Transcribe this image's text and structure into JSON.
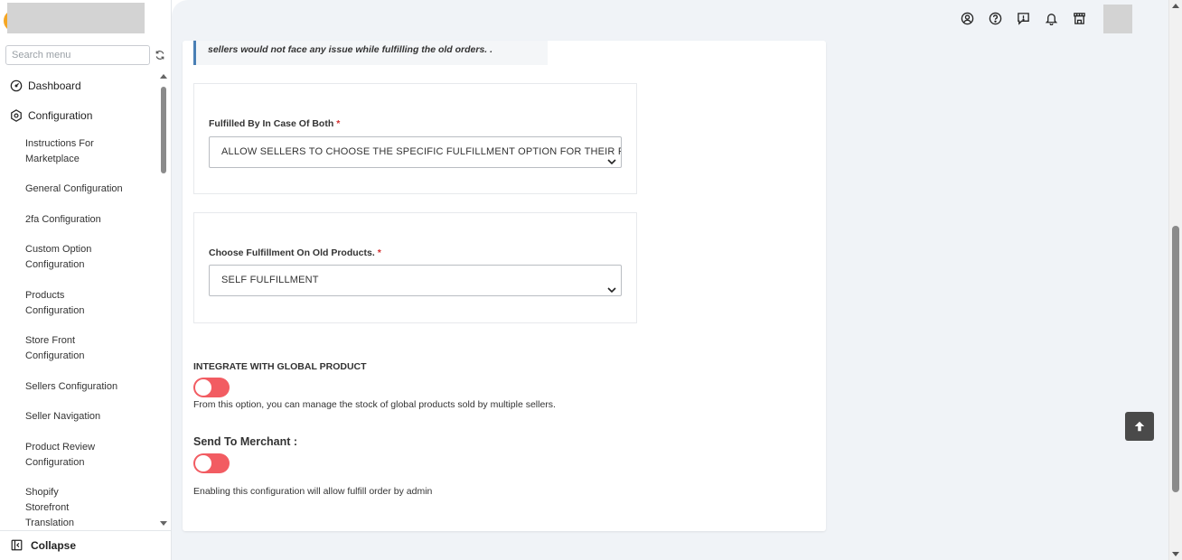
{
  "sidebar": {
    "search_placeholder": "Search menu",
    "top_items": [
      {
        "label": "Dashboard",
        "icon": "dashboard-icon"
      },
      {
        "label": "Configuration",
        "icon": "hexagon-gear-icon"
      }
    ],
    "sub_items": [
      "Instructions For Marketplace",
      "General Configuration",
      "2fa Configuration",
      "Custom Option Configuration",
      "Products Configuration",
      "Store Front Configuration",
      "Sellers Configuration",
      "Seller Navigation",
      "Product Review Configuration",
      "Shopify Storefront Translation"
    ],
    "collapse_label": "Collapse"
  },
  "topbar": {
    "icons": [
      "user-circle-icon",
      "help-circle-icon",
      "feedback-icon",
      "bell-icon",
      "store-icon"
    ]
  },
  "content": {
    "note": "sellers would not face any issue while fulfilling the old orders. .",
    "fulfilled_by": {
      "label": "Fulfilled By In Case Of Both",
      "required_mark": "*",
      "value": "ALLOW SELLERS TO CHOOSE THE SPECIFIC FULFILLMENT OPTION FOR THEIR P"
    },
    "old_products": {
      "label": "Choose Fulfillment On Old Products.",
      "required_mark": "*",
      "value": "SELF FULFILLMENT"
    },
    "global_product": {
      "title": "INTEGRATE WITH GLOBAL PRODUCT",
      "toggle_on": false,
      "helper": "From this option, you can manage the stock of global products sold by multiple sellers."
    },
    "send_to_merchant": {
      "title": "Send To Merchant :",
      "toggle_on": false,
      "helper": "Enabling this configuration will allow fulfill order by admin"
    }
  },
  "colors": {
    "toggle_off": "#f25c62",
    "note_border": "#4a7fb5",
    "required": "#d32f2f",
    "logo_accent": "#f5a623"
  }
}
